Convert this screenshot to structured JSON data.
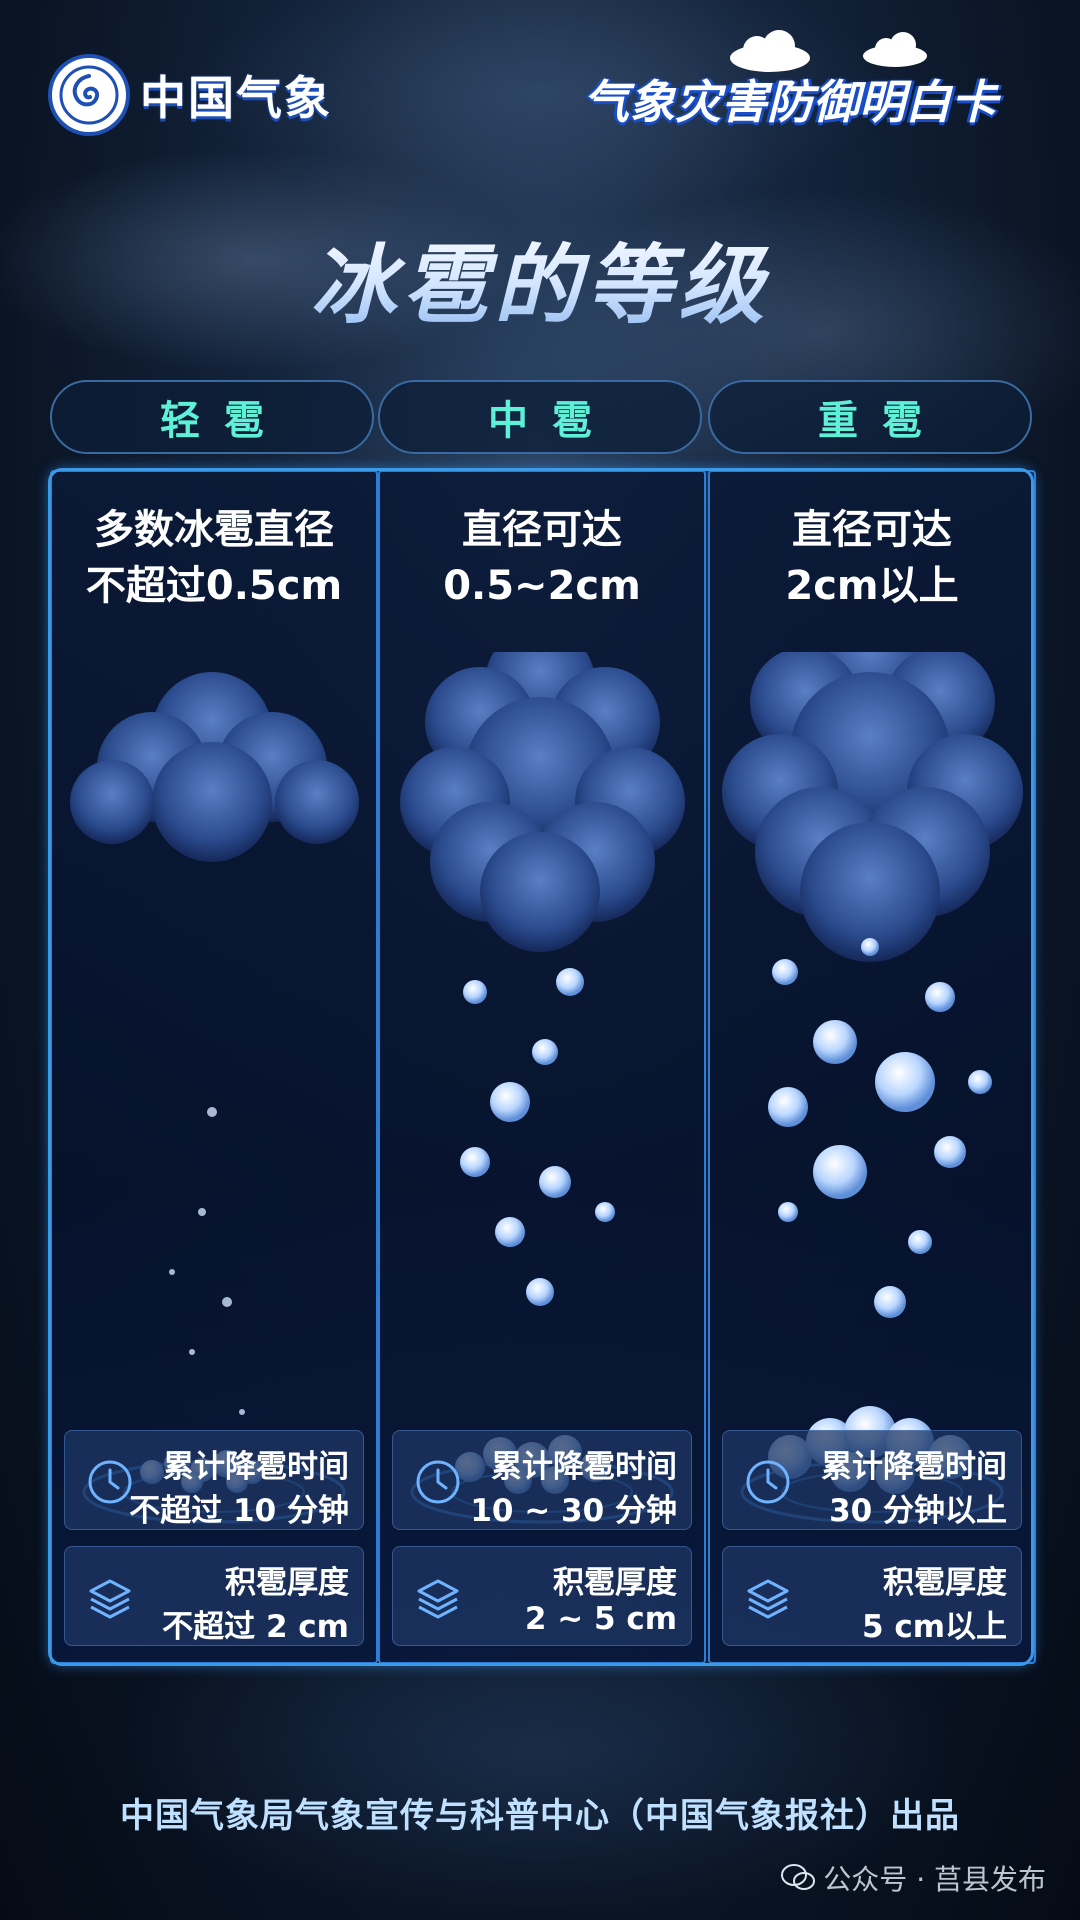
{
  "header": {
    "logo_text": "中国气象",
    "card_title": "气象灾害防御明白卡"
  },
  "main_title": "冰雹的等级",
  "levels": [
    {
      "tab": "轻雹",
      "desc_line1": "多数冰雹直径",
      "desc_line2": "不超过0.5cm",
      "time_label": "累计降雹时间",
      "time_value": "不超过 10 分钟",
      "depth_label": "积雹厚度",
      "depth_value": "不超过 2 cm"
    },
    {
      "tab": "中雹",
      "desc_line1": "直径可达",
      "desc_line2": "0.5~2cm",
      "time_label": "累计降雹时间",
      "time_value": "10 ~ 30 分钟",
      "depth_label": "积雹厚度",
      "depth_value": "2 ~ 5 cm"
    },
    {
      "tab": "重雹",
      "desc_line1": "直径可达",
      "desc_line2": "2cm以上",
      "time_label": "累计降雹时间",
      "time_value": "30 分钟以上",
      "depth_label": "积雹厚度",
      "depth_value": "5 cm以上"
    }
  ],
  "footer": "中国气象局气象宣传与科普中心（中国气象报社）出品",
  "watermark": "公众号 · 莒县发布",
  "icons": {
    "clock": "clock-icon",
    "layers": "layers-icon",
    "logo": "cma-logo-icon",
    "wechat": "wechat-icon"
  },
  "colors": {
    "tab_text": "#5ff0d8",
    "frame": "#3a9ae8",
    "footer_text": "#bfe0ff"
  }
}
